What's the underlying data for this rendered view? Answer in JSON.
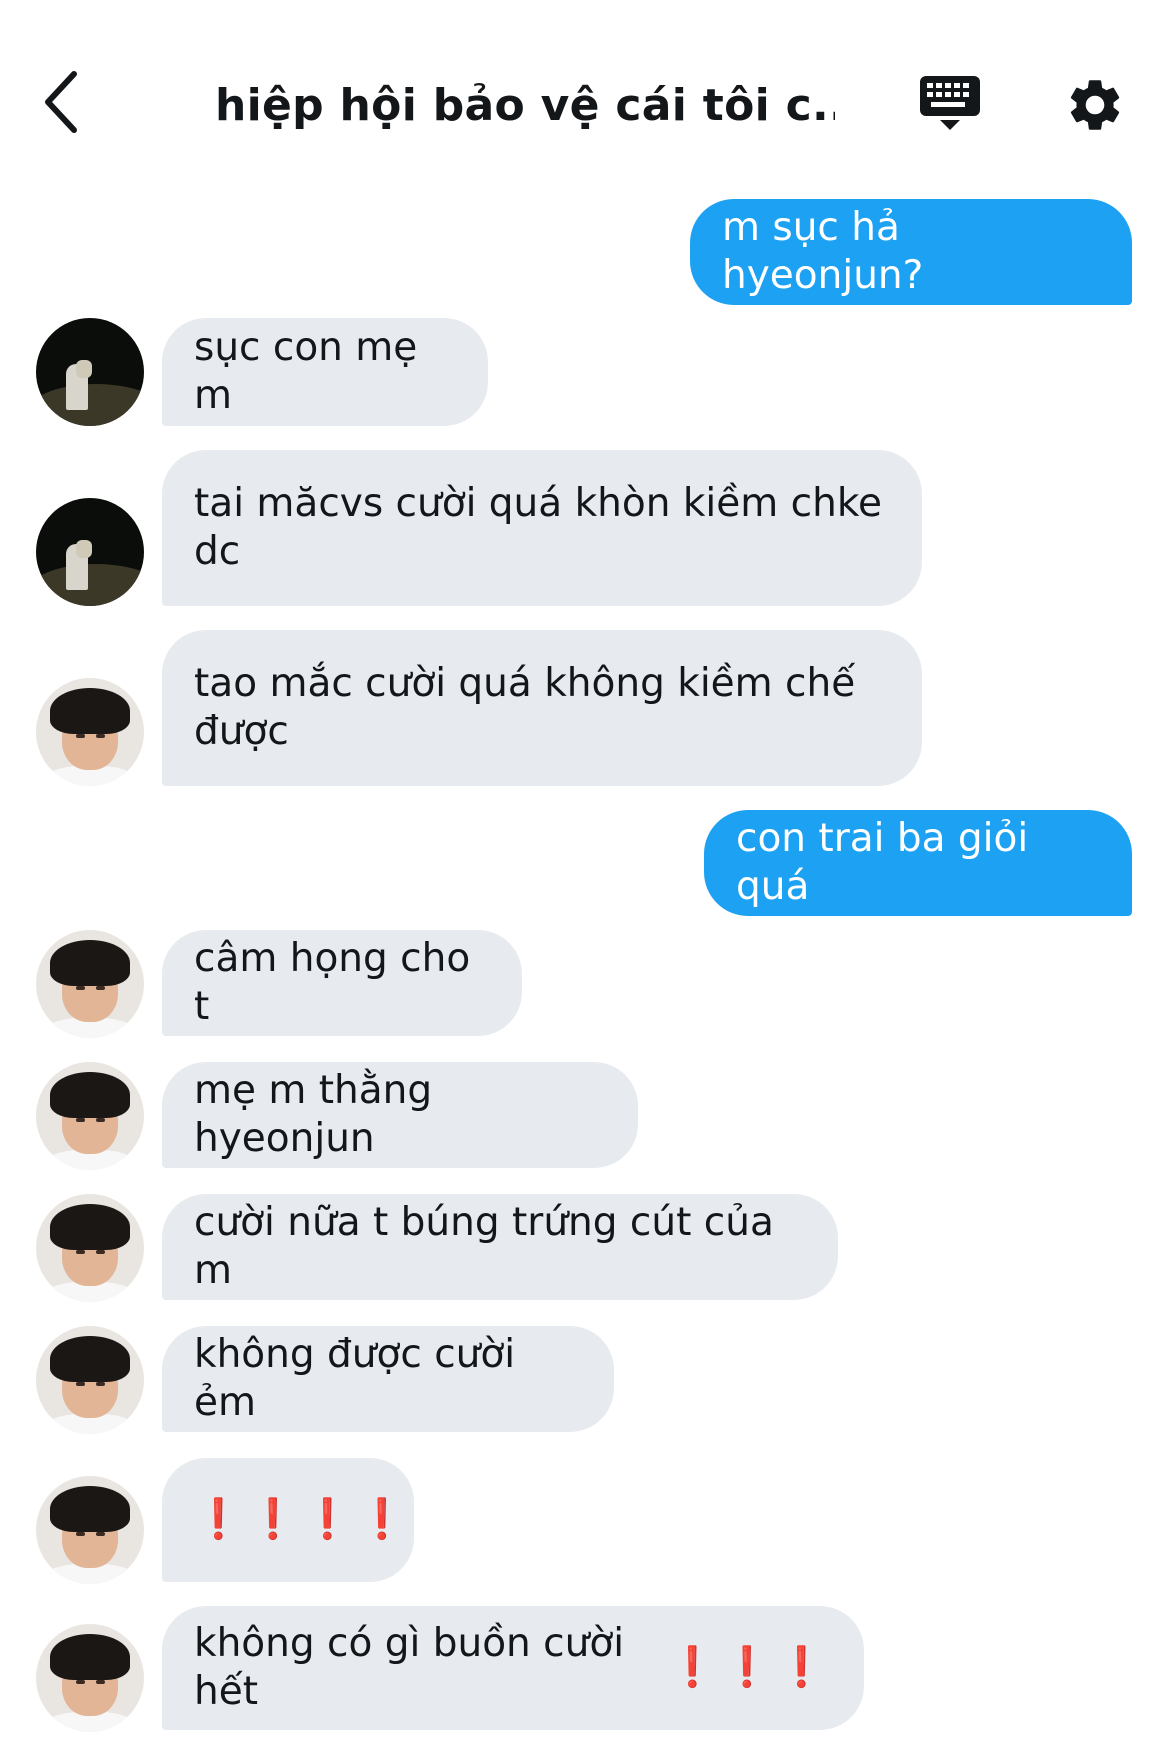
{
  "header": {
    "title": "hiệp hội bảo vệ cái tôi c...",
    "back_icon": "chevron-left-icon",
    "keyboard_icon": "keyboard-icon",
    "settings_icon": "gear-icon"
  },
  "colors": {
    "outgoing_bubble": "#1da1f2",
    "incoming_bubble": "#e7ebef",
    "text": "#14171a",
    "exclamation": "#e0202a"
  },
  "messages": [
    {
      "direction": "out",
      "text": "m sục hả hyeonjun?"
    },
    {
      "direction": "in",
      "avatar": "night-beach-photo",
      "text": "sục con mẹ m"
    },
    {
      "direction": "in",
      "avatar": "night-beach-photo",
      "lines": [
        "tai măcvs cười quá khòn kiềm chke",
        "dc"
      ]
    },
    {
      "direction": "in",
      "avatar": "young-man-photo",
      "lines": [
        "tao mắc cười quá không kiềm chế",
        "được"
      ]
    },
    {
      "direction": "out",
      "text": "con trai ba giỏi quá"
    },
    {
      "direction": "in",
      "avatar": "young-man-photo",
      "text": "câm họng cho t"
    },
    {
      "direction": "in",
      "avatar": "young-man-photo",
      "text": "mẹ m thằng hyeonjun"
    },
    {
      "direction": "in",
      "avatar": "young-man-photo",
      "text": "cười nữa t búng trứng cút của m"
    },
    {
      "direction": "in",
      "avatar": "young-man-photo",
      "text": "không được cười ẻm"
    },
    {
      "direction": "in",
      "avatar": "young-man-photo",
      "text": "",
      "emoji": "❗️❗️❗️❗️"
    },
    {
      "direction": "in",
      "avatar": "young-man-photo",
      "text": "không có gì buồn cười hết",
      "emoji": "❗️❗️❗️"
    }
  ]
}
